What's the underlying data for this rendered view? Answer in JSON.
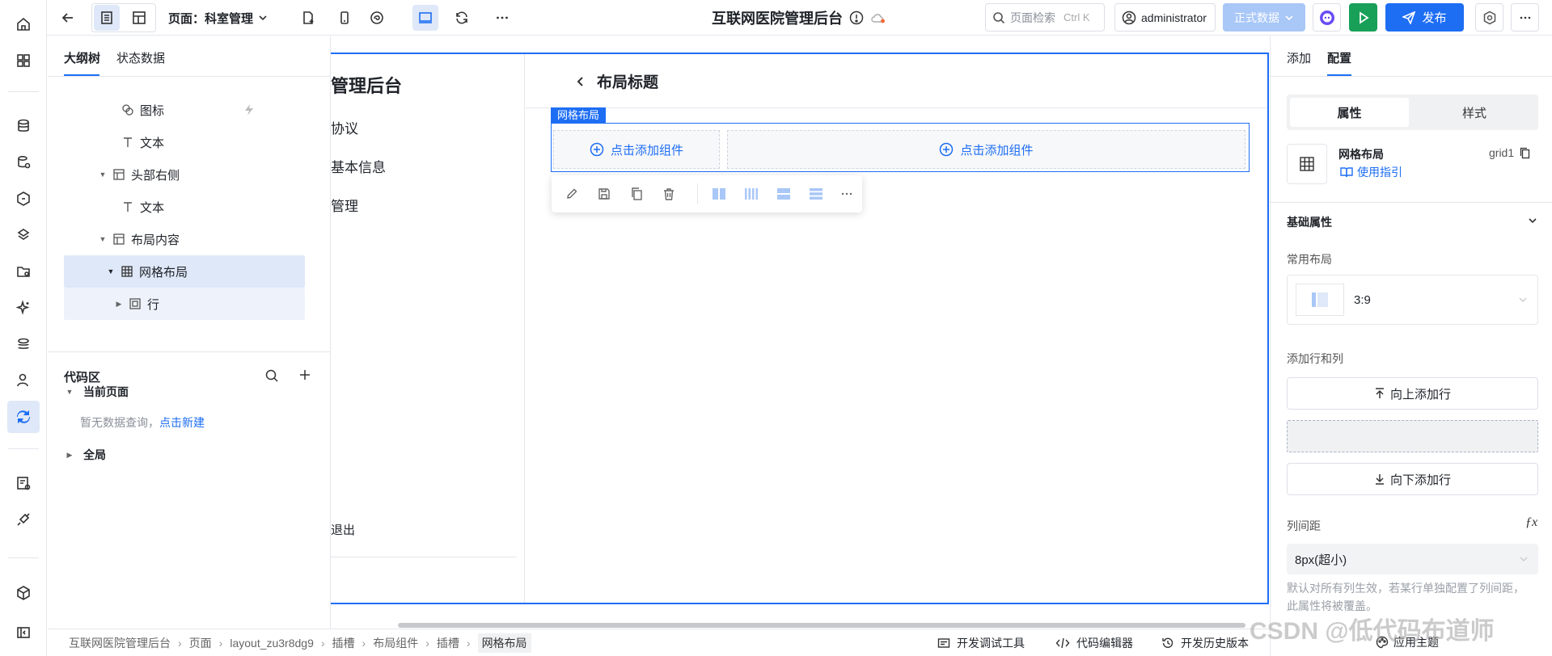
{
  "topbar": {
    "page_label": "页面：科室管理",
    "app_title": "互联网医院管理后台",
    "search_placeholder": "页面检索",
    "search_shortcut": "Ctrl K",
    "user_name": "administrator",
    "data_env": "正式数据",
    "publish_label": "发布"
  },
  "left_panel": {
    "tabs": [
      "大纲树",
      "状态数据"
    ],
    "tree": [
      {
        "label": "图标",
        "icon": "icon-component-icon"
      },
      {
        "label": "文本",
        "icon": "text-icon"
      },
      {
        "label": "头部右侧",
        "icon": "layout-icon"
      },
      {
        "label": "文本",
        "icon": "text-icon"
      },
      {
        "label": "布局内容",
        "icon": "layout-icon"
      },
      {
        "label": "网格布局",
        "icon": "grid-icon"
      },
      {
        "label": "行",
        "icon": "row-icon"
      }
    ],
    "code_area": {
      "title": "代码区",
      "current_page": "当前页面",
      "empty_text": "暂无数据查询，",
      "create_link": "点击新建",
      "global": "全局"
    }
  },
  "canvas": {
    "menu_title": "管理后台",
    "menu_items": [
      "协议",
      "基本信息",
      "管理"
    ],
    "logout": "退出",
    "content_title": "布局标题",
    "grid_tag": "网格布局",
    "add_component": "点击添加组件"
  },
  "right_panel": {
    "tabs": [
      "添加",
      "配置"
    ],
    "segment": [
      "属性",
      "样式"
    ],
    "component_name": "网格布局",
    "component_id": "grid1",
    "guide_link": "使用指引",
    "section_basic": "基础属性",
    "common_layout_label": "常用布局",
    "common_layout_value": "3:9",
    "add_rows_label": "添加行和列",
    "add_row_above": "向上添加行",
    "add_row_below": "向下添加行",
    "col_gap_label": "列间距",
    "col_gap_value": "8px(超小)",
    "col_gap_help": "默认对所有列生效，若某行单独配置了列间距，此属性将被覆盖。",
    "apply_theme": "应用主题"
  },
  "statusbar": {
    "breadcrumbs": [
      "互联网医院管理后台",
      "页面",
      "layout_zu3r8dg9",
      "插槽",
      "布局组件",
      "插槽",
      "网格布局"
    ],
    "tools": [
      "开发调试工具",
      "代码编辑器",
      "开发历史版本"
    ]
  },
  "watermark": "CSDN @低代码布道师",
  "colors": {
    "accent": "#1e6ef4",
    "run": "#18a058",
    "data_env": "#a9c7f7"
  }
}
